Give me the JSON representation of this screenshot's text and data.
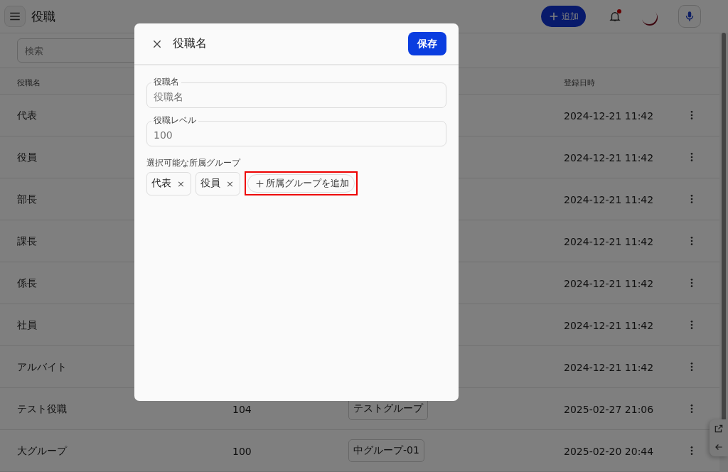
{
  "app_bar": {
    "title": "役職",
    "add_button": "追加",
    "notification_dot": true
  },
  "search": {
    "placeholder": "検索"
  },
  "table": {
    "columns": [
      "役職名",
      "登録日時"
    ],
    "rows": [
      {
        "name": "代表",
        "date": "2024-12-21 11:42"
      },
      {
        "name": "役員",
        "date": "2024-12-21 11:42"
      },
      {
        "name": "部長",
        "date": "2024-12-21 11:42"
      },
      {
        "name": "課長",
        "date": "2024-12-21 11:42"
      },
      {
        "name": "係長",
        "date": "2024-12-21 11:42"
      },
      {
        "name": "社員",
        "date": "2024-12-21 11:42"
      },
      {
        "name": "アルバイト",
        "date": "2024-12-21 11:42"
      },
      {
        "name": "テスト役職",
        "level": "104",
        "group": "テストグループ",
        "date": "2025-02-27 21:06"
      },
      {
        "name": "大グループ",
        "level": "100",
        "group": "中グループ-01",
        "date": "2025-02-20 20:44"
      }
    ]
  },
  "dialog": {
    "title": "役職名",
    "save_button": "保存",
    "fields": [
      {
        "label": "役職名",
        "placeholder": "役職名"
      },
      {
        "label": "役職レベル",
        "placeholder": "100"
      }
    ],
    "groups_label": "選択可能な所属グループ",
    "chips": [
      {
        "label": "代表",
        "remove": "×"
      },
      {
        "label": "役員",
        "remove": "×"
      }
    ],
    "add_group_button": {
      "label": "所属グループを追加",
      "highlighted": true
    }
  }
}
